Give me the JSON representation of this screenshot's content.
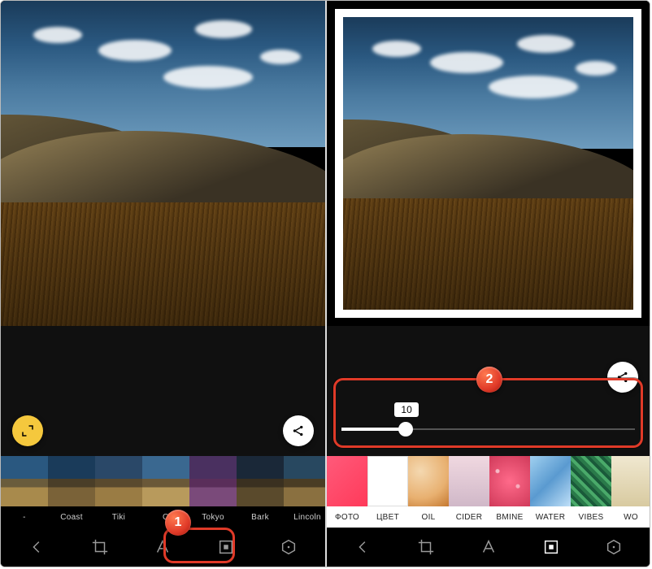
{
  "left": {
    "fab_expand_icon": "expand-icon",
    "fab_share_icon": "share-icon",
    "filters": [
      {
        "label": "-"
      },
      {
        "label": "Coast"
      },
      {
        "label": "Tiki"
      },
      {
        "label": "O"
      },
      {
        "label": "Tokyo"
      },
      {
        "label": "Bark"
      },
      {
        "label": "Lincoln"
      }
    ],
    "toolbar": {
      "crop": "crop",
      "text": "A",
      "frame": "frame",
      "shape": "shape"
    },
    "callout": {
      "number": "1"
    }
  },
  "right": {
    "fab_share_icon": "share-icon",
    "slider": {
      "value": "10",
      "percent": 22
    },
    "backgrounds": [
      {
        "label": "ФОТО"
      },
      {
        "label": "ЦВЕТ"
      },
      {
        "label": "OIL"
      },
      {
        "label": "CIDER"
      },
      {
        "label": "BMINE"
      },
      {
        "label": "WATER"
      },
      {
        "label": "VIBES"
      },
      {
        "label": "WO"
      }
    ],
    "toolbar": {
      "crop": "crop",
      "text": "A",
      "frame": "frame",
      "shape": "shape"
    },
    "callout": {
      "number": "2"
    }
  }
}
